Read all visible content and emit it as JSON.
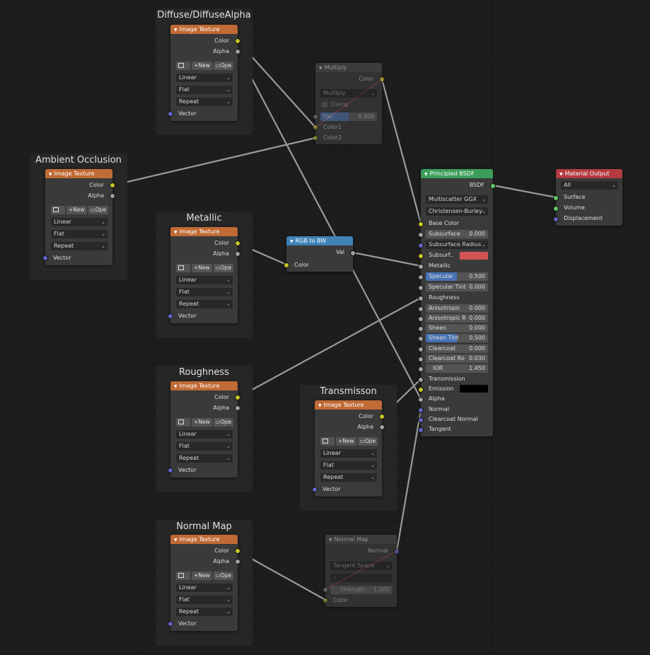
{
  "frames": {
    "diffuse": "Diffuse/DiffuseAlpha",
    "ao": "Ambient Occlusion",
    "metallic": "Metallic",
    "roughness": "Roughness",
    "transmission": "Transmisson",
    "normal": "Normal Map"
  },
  "image_texture": {
    "title": "Image Texture",
    "out_color": "Color",
    "out_alpha": "Alpha",
    "new_label": "New",
    "open_label": "Ope",
    "interpolation": "Linear",
    "projection": "Flat",
    "extension": "Repeat",
    "in_vector": "Vector"
  },
  "multiply": {
    "title": "Multiply",
    "out_color": "Color",
    "blend_mode": "Multiply",
    "clamp": "Clamp",
    "fac_label": "Fac",
    "fac_value": "0.500",
    "fac": 0.5,
    "in_color1": "Color1",
    "in_color2": "Color2"
  },
  "rgb_to_bw": {
    "title": "RGB to BW",
    "out_val": "Val",
    "in_color": "Color"
  },
  "bsdf": {
    "title": "Principled BSDF",
    "out": "BSDF",
    "distribution": "Multiscatter GGX",
    "subsurface_method": "Christensen-Burley",
    "base_color": "Base Color",
    "subsurface": {
      "label": "Subsurface",
      "value": "0.000"
    },
    "subsurface_radius": "Subsurface Radius",
    "subsurface_color": "Subsurf..",
    "metallic": "Metallic",
    "specular": {
      "label": "Specular",
      "value": "0.500",
      "fill": 0.5
    },
    "specular_tint": {
      "label": "Specular Tint",
      "value": "0.000"
    },
    "roughness": "Roughness",
    "anisotropic": {
      "label": "Anisotropic",
      "value": "0.000"
    },
    "anisotropic_rotation": {
      "label": "Anisotropic R",
      "value": "0.000"
    },
    "sheen": {
      "label": "Sheen",
      "value": "0.000"
    },
    "sheen_tint": {
      "label": "Sheen Tint",
      "value": "0.500",
      "fill": 0.5
    },
    "clearcoat": {
      "label": "Clearcoat",
      "value": "0.000"
    },
    "clearcoat_roughness": {
      "label": "Clearcoat Ro",
      "value": "0.030"
    },
    "ior": {
      "label": "IOR",
      "value": "1.450"
    },
    "transmission": "Transmission",
    "emission": "Emission",
    "alpha": "Alpha",
    "normal": "Normal",
    "clearcoat_normal": "Clearcoat Normal",
    "tangent": "Tangent",
    "subsurface_color_hex": "#d25454",
    "emission_color_hex": "#000000"
  },
  "material_output": {
    "title": "Material Output",
    "target": "All",
    "surface": "Surface",
    "volume": "Volume",
    "displacement": "Displacement"
  },
  "normal_map": {
    "title": "Normal Map",
    "out_normal": "Normal",
    "space": "Tangent Space",
    "strength_label": "Strength",
    "strength_value": "1.000",
    "in_color": "Color"
  },
  "colors": {
    "texture_header": "#c06a35",
    "converter_header": "#3f82b6",
    "shader_header": "#3c9d5a",
    "output_header": "#b33b41",
    "wire": "#9a9a9a",
    "invalid_wire": "#d83a3a"
  }
}
